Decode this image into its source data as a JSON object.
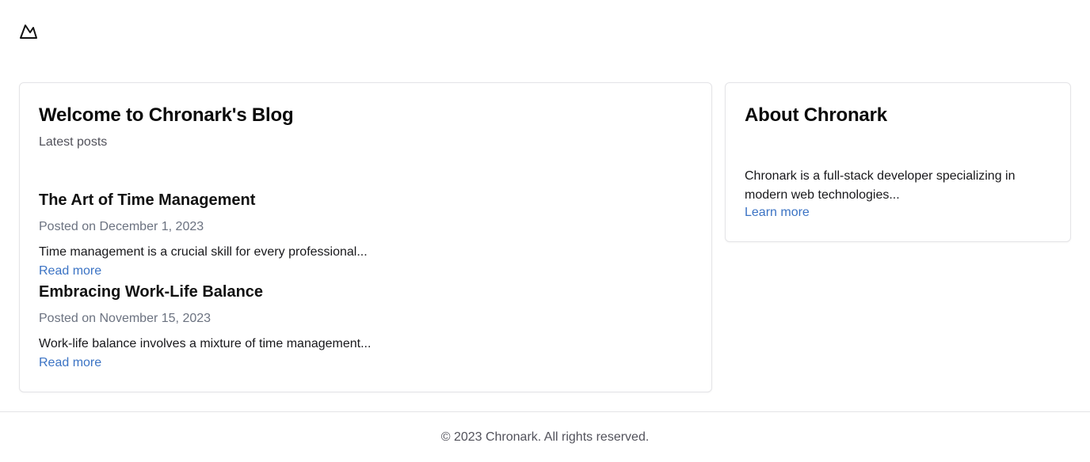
{
  "header": {
    "logo_icon": "mountain-logo-icon"
  },
  "blog": {
    "title": "Welcome to Chronark's Blog",
    "subtitle": "Latest posts",
    "posts": [
      {
        "title": "The Art of Time Management",
        "date": "Posted on December 1, 2023",
        "excerpt": "Time management is a crucial skill for every professional...",
        "link_label": "Read more"
      },
      {
        "title": "Embracing Work-Life Balance",
        "date": "Posted on November 15, 2023",
        "excerpt": "Work-life balance involves a mixture of time management...",
        "link_label": "Read more"
      }
    ]
  },
  "about": {
    "title": "About Chronark",
    "text": "Chronark is a full-stack developer specializing in modern web technologies...",
    "link_label": "Learn more"
  },
  "footer": {
    "text": "© 2023 Chronark. All rights reserved."
  },
  "colors": {
    "link": "#3b73c4",
    "border": "#e4e4e7",
    "muted_text": "#6b7280"
  }
}
